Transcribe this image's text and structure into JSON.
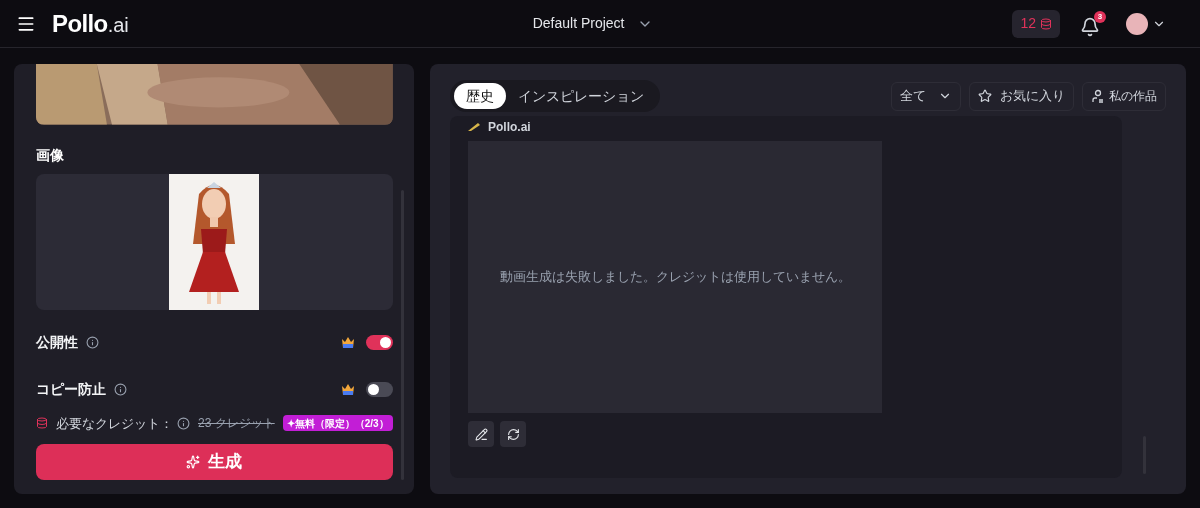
{
  "header": {
    "logo_main": "Pollo",
    "logo_suffix": ".ai",
    "project": "Default Project",
    "credits": "12",
    "notifications": "3"
  },
  "left_panel": {
    "image_label": "画像",
    "settings": [
      {
        "label": "公開性",
        "premium": true,
        "on": true
      },
      {
        "label": "コピー防止",
        "premium": true,
        "on": false
      }
    ],
    "credits_label": "必要なクレジット：",
    "credits_old": "23 クレジット",
    "free_badge": "✦無料（限定）（2/3）",
    "generate": "生成"
  },
  "right_panel": {
    "tabs": [
      {
        "label": "歴史",
        "selected": true
      },
      {
        "label": "インスピレーション",
        "selected": false
      }
    ],
    "filter": "全て",
    "favorites": "お気に入り",
    "my_works": "私の作品",
    "entry": {
      "source": "Pollo.ai",
      "message": "動画生成は失敗しました。クレジットは使用していません。"
    }
  }
}
